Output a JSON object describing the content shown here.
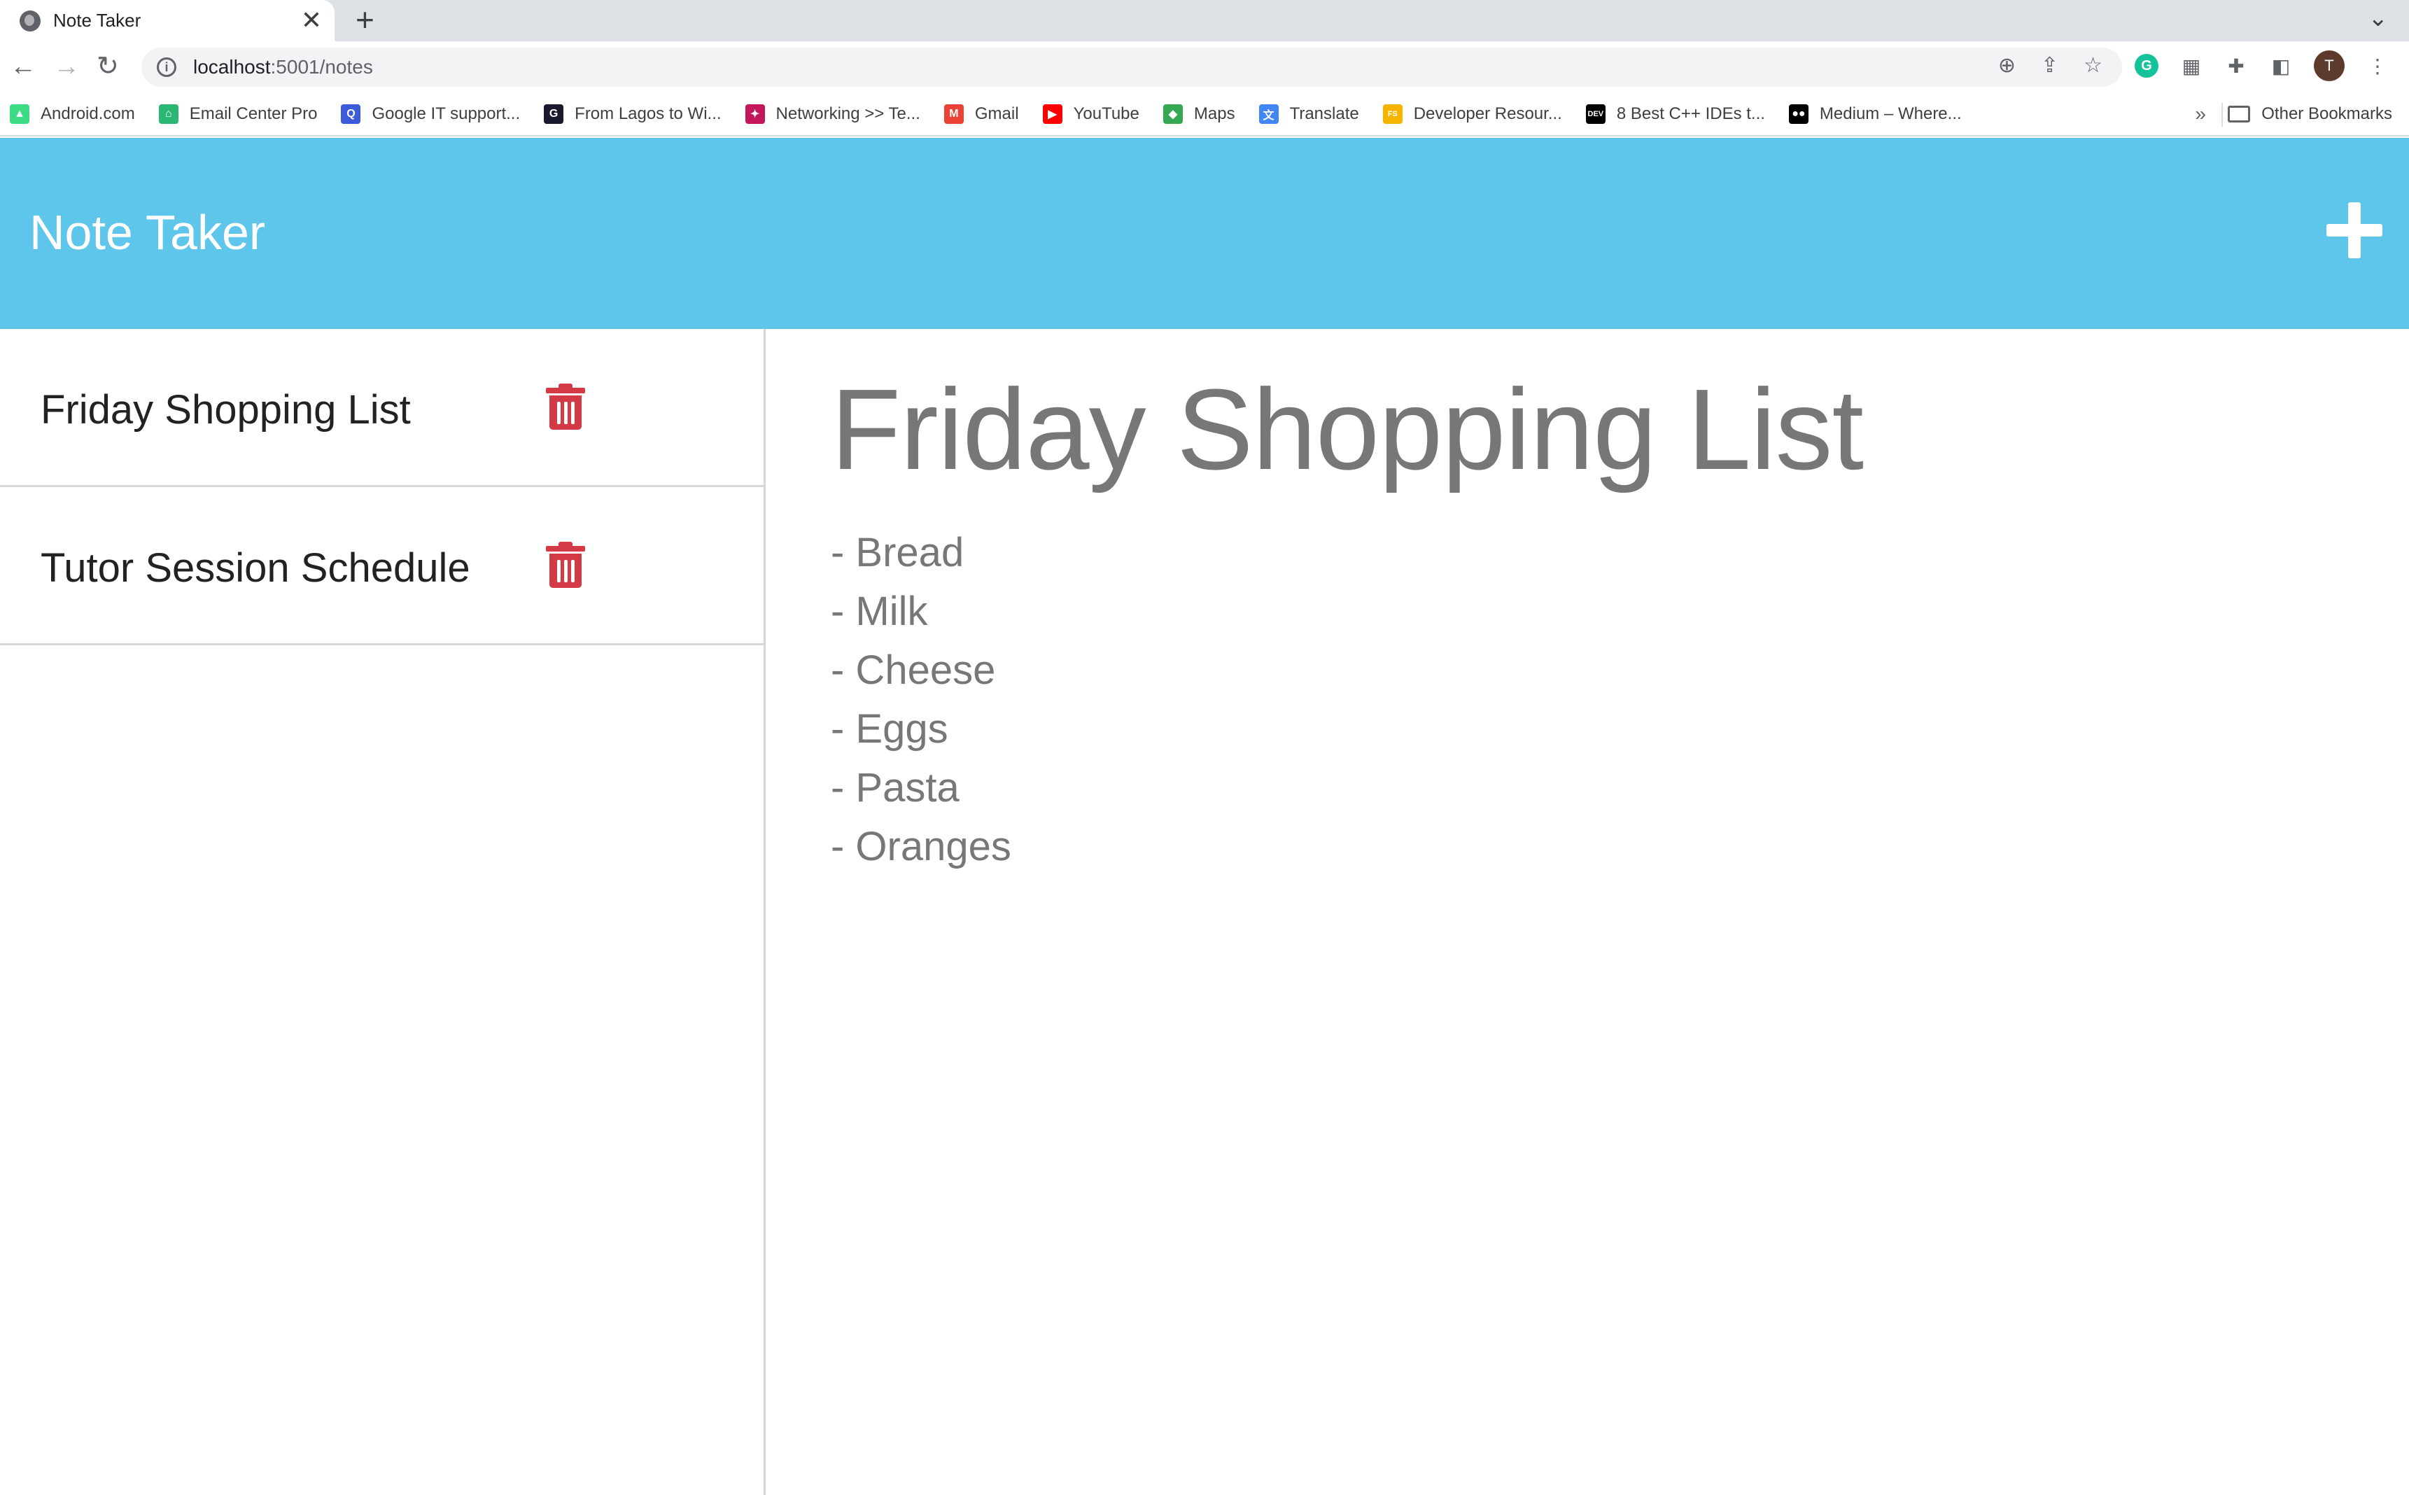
{
  "browser": {
    "tab_title": "Note Taker",
    "tab_close": "✕",
    "new_tab": "+",
    "url_host": "localhost",
    "url_path": ":5001/notes",
    "profile_initial": "T",
    "bookmarks": [
      {
        "label": "Android.com",
        "icon": "android-icon",
        "color": "#3ddc84"
      },
      {
        "label": "Email Center Pro",
        "icon": "email-center-icon",
        "color": "#2ab673"
      },
      {
        "label": "Google IT support...",
        "icon": "search-q-icon",
        "color": "#3b5bdb"
      },
      {
        "label": "From Lagos to Wi...",
        "icon": "medium-g-icon",
        "color": "#1a1a2e"
      },
      {
        "label": "Networking >> Te...",
        "icon": "networking-icon",
        "color": "#c2185b"
      },
      {
        "label": "Gmail",
        "icon": "gmail-icon",
        "color": "#ea4335"
      },
      {
        "label": "YouTube",
        "icon": "youtube-icon",
        "color": "#ff0000"
      },
      {
        "label": "Maps",
        "icon": "maps-icon",
        "color": "#34a853"
      },
      {
        "label": "Translate",
        "icon": "translate-icon",
        "color": "#4285f4"
      },
      {
        "label": "Developer Resour...",
        "icon": "fs-icon",
        "color": "#f4b400"
      },
      {
        "label": "8 Best C++ IDEs t...",
        "icon": "dev-icon",
        "color": "#000000"
      },
      {
        "label": "Medium – Where...",
        "icon": "medium-icon",
        "color": "#000000"
      }
    ],
    "more_bookmarks": "»",
    "other_bookmarks": "Other Bookmarks"
  },
  "app": {
    "title": "Note Taker",
    "header_color": "#5ec6eb"
  },
  "notes": [
    {
      "title": "Friday Shopping List"
    },
    {
      "title": "Tutor Session Schedule"
    }
  ],
  "active_note": {
    "title": "Friday Shopping List",
    "lines": [
      "- Bread",
      "- Milk",
      "- Cheese",
      "- Eggs",
      "- Pasta",
      "- Oranges"
    ]
  },
  "colors": {
    "delete_icon": "#d33a45",
    "note_text": "#777777"
  }
}
